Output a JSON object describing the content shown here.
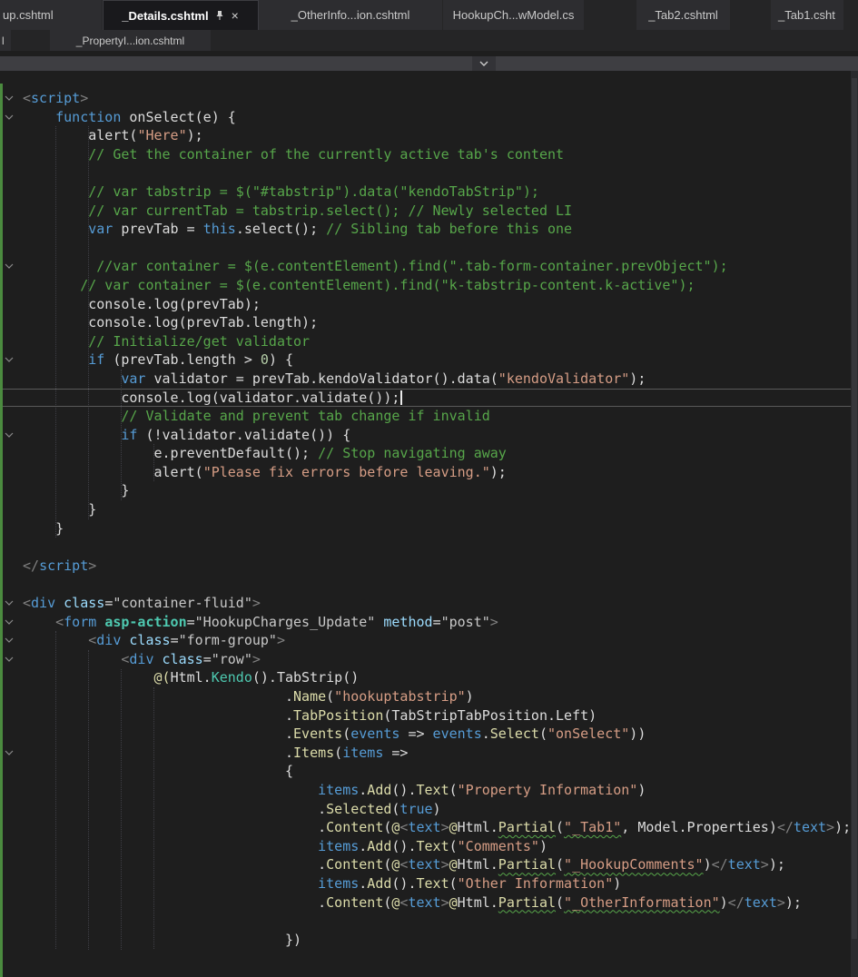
{
  "colors": {
    "background": "#1e1e1e",
    "tab_strip": "#252526",
    "tab_inactive": "#2d2d30",
    "tab_active": "#19191c",
    "keyword": "#569cd6",
    "string": "#d69d85",
    "comment": "#57a64a",
    "number": "#b5cea8",
    "method": "#dcdcaa",
    "type_teal": "#4ec9b0",
    "attribute": "#9cdcfe",
    "squiggle": "#57a64a",
    "change_bar": "#4b8b3f"
  },
  "icons": {
    "close_glyph": "×",
    "pin": "pin-icon",
    "fold": "chevron-down-icon",
    "overflow": "chevron-down-icon"
  },
  "tabs": {
    "row1": [
      {
        "label": "up.cshtml"
      },
      {
        "label": "_Details.cshtml",
        "active": true,
        "pinned": true,
        "closable": true
      },
      {
        "label": "_OtherInfo...ion.cshtml"
      },
      {
        "label": "HookupCh...wModel.cs"
      },
      {
        "label": "_Tab2.cshtml"
      },
      {
        "label": "_Tab1.csht"
      }
    ],
    "row2": [
      {
        "label": "l"
      },
      {
        "label": "_PropertyI...ion.cshtml"
      }
    ]
  },
  "editor": {
    "lines": [
      {
        "fold": true,
        "t": [
          [
            "tb",
            "<"
          ],
          [
            "tag",
            "script"
          ],
          [
            "tb",
            ">"
          ]
        ]
      },
      {
        "fold": true,
        "t": [
          [
            "d",
            "    "
          ],
          [
            "k",
            "function"
          ],
          [
            "d",
            " onSelect(e) {"
          ]
        ]
      },
      {
        "t": [
          [
            "d",
            "        alert("
          ],
          [
            "s",
            "\"Here\""
          ],
          [
            "d",
            ");"
          ]
        ]
      },
      {
        "t": [
          [
            "c",
            "        // Get the container of the currently active tab's content"
          ]
        ]
      },
      {
        "t": []
      },
      {
        "t": [
          [
            "c",
            "        // var tabstrip = $(\"#tabstrip\").data(\"kendoTabStrip\");"
          ]
        ]
      },
      {
        "t": [
          [
            "c",
            "        // var currentTab = tabstrip.select(); // Newly selected LI"
          ]
        ]
      },
      {
        "t": [
          [
            "d",
            "        "
          ],
          [
            "k",
            "var"
          ],
          [
            "d",
            " prevTab = "
          ],
          [
            "k",
            "this"
          ],
          [
            "d",
            ".select(); "
          ],
          [
            "c",
            "// Sibling tab before this one"
          ]
        ]
      },
      {
        "t": []
      },
      {
        "fold": true,
        "t": [
          [
            "c",
            "         //var container = $(e.contentElement).find(\".tab-form-container.prevObject\");"
          ]
        ]
      },
      {
        "t": [
          [
            "c",
            "       // var container = $(e.contentElement).find(\"k-tabstrip-content.k-active\");"
          ]
        ]
      },
      {
        "t": [
          [
            "d",
            "        console.log(prevTab);"
          ]
        ]
      },
      {
        "t": [
          [
            "d",
            "        console.log(prevTab.length);"
          ]
        ]
      },
      {
        "t": [
          [
            "c",
            "        // Initialize/get validator"
          ]
        ]
      },
      {
        "fold": true,
        "t": [
          [
            "d",
            "        "
          ],
          [
            "k",
            "if"
          ],
          [
            "d",
            " (prevTab.length > "
          ],
          [
            "n",
            "0"
          ],
          [
            "d",
            ") {"
          ]
        ]
      },
      {
        "t": [
          [
            "d",
            "            "
          ],
          [
            "k",
            "var"
          ],
          [
            "d",
            " validator = prevTab.kendoValidator().data("
          ],
          [
            "s",
            "\"kendoValidator\""
          ],
          [
            "d",
            ");"
          ]
        ]
      },
      {
        "cur": true,
        "t": [
          [
            "d",
            "            console.log(validator.validate());"
          ]
        ]
      },
      {
        "t": [
          [
            "c",
            "            // Validate and prevent tab change if invalid"
          ]
        ]
      },
      {
        "fold": true,
        "t": [
          [
            "d",
            "            "
          ],
          [
            "k",
            "if"
          ],
          [
            "d",
            " (!validator.validate()) {"
          ]
        ]
      },
      {
        "t": [
          [
            "d",
            "                e.preventDefault(); "
          ],
          [
            "c",
            "// Stop navigating away"
          ]
        ]
      },
      {
        "t": [
          [
            "d",
            "                alert("
          ],
          [
            "s",
            "\"Please fix errors before leaving.\""
          ],
          [
            "d",
            ");"
          ]
        ]
      },
      {
        "t": [
          [
            "d",
            "            }"
          ]
        ]
      },
      {
        "t": [
          [
            "d",
            "        }"
          ]
        ]
      },
      {
        "t": [
          [
            "d",
            "    }"
          ]
        ]
      },
      {
        "t": []
      },
      {
        "t": [
          [
            "tb",
            "</"
          ],
          [
            "tag",
            "script"
          ],
          [
            "tb",
            ">"
          ]
        ]
      },
      {
        "t": []
      },
      {
        "fold": true,
        "t": [
          [
            "tb",
            "<"
          ],
          [
            "tag",
            "div"
          ],
          [
            "d",
            " "
          ],
          [
            "at",
            "class"
          ],
          [
            "d",
            "="
          ],
          [
            "av",
            "\"container-fluid\""
          ],
          [
            "tb",
            ">"
          ]
        ]
      },
      {
        "fold": true,
        "t": [
          [
            "d",
            "    "
          ],
          [
            "tb",
            "<"
          ],
          [
            "tag",
            "form"
          ],
          [
            "d",
            " "
          ],
          [
            "th",
            "asp-action"
          ],
          [
            "d",
            "="
          ],
          [
            "av",
            "\"HookupCharges_Update\""
          ],
          [
            "d",
            " "
          ],
          [
            "at",
            "method"
          ],
          [
            "d",
            "="
          ],
          [
            "av",
            "\"post\""
          ],
          [
            "tb",
            ">"
          ]
        ]
      },
      {
        "fold": true,
        "t": [
          [
            "d",
            "        "
          ],
          [
            "tb",
            "<"
          ],
          [
            "tag",
            "div"
          ],
          [
            "d",
            " "
          ],
          [
            "at",
            "class"
          ],
          [
            "d",
            "="
          ],
          [
            "av",
            "\"form-group\""
          ],
          [
            "tb",
            ">"
          ]
        ]
      },
      {
        "fold": true,
        "t": [
          [
            "d",
            "            "
          ],
          [
            "tb",
            "<"
          ],
          [
            "tag",
            "div"
          ],
          [
            "d",
            " "
          ],
          [
            "at",
            "class"
          ],
          [
            "d",
            "="
          ],
          [
            "av",
            "\"row\""
          ],
          [
            "tb",
            ">"
          ]
        ]
      },
      {
        "t": [
          [
            "d",
            "                "
          ],
          [
            "rz",
            "@("
          ],
          [
            "d",
            "Html."
          ],
          [
            "te",
            "Kendo"
          ],
          [
            "d",
            "().TabStrip()"
          ]
        ]
      },
      {
        "t": [
          [
            "d",
            "                                ."
          ],
          [
            "m",
            "Name"
          ],
          [
            "d",
            "("
          ],
          [
            "s",
            "\"hookuptabstrip\""
          ],
          [
            "d",
            ")"
          ]
        ]
      },
      {
        "t": [
          [
            "d",
            "                                ."
          ],
          [
            "m",
            "TabPosition"
          ],
          [
            "d",
            "(TabStripTabPosition.Left)"
          ]
        ]
      },
      {
        "t": [
          [
            "d",
            "                                ."
          ],
          [
            "m",
            "Events"
          ],
          [
            "d",
            "("
          ],
          [
            "pb",
            "events"
          ],
          [
            "d",
            " => "
          ],
          [
            "pb",
            "events"
          ],
          [
            "d",
            "."
          ],
          [
            "m",
            "Select"
          ],
          [
            "d",
            "("
          ],
          [
            "s",
            "\"onSelect\""
          ],
          [
            "d",
            "))"
          ]
        ]
      },
      {
        "fold": true,
        "t": [
          [
            "d",
            "                                ."
          ],
          [
            "m",
            "Items"
          ],
          [
            "d",
            "("
          ],
          [
            "pb",
            "items"
          ],
          [
            "d",
            " =>"
          ]
        ]
      },
      {
        "t": [
          [
            "d",
            "                                {"
          ]
        ]
      },
      {
        "t": [
          [
            "d",
            "                                    "
          ],
          [
            "pb",
            "items"
          ],
          [
            "d",
            "."
          ],
          [
            "m",
            "Add"
          ],
          [
            "d",
            "()."
          ],
          [
            "m",
            "Text"
          ],
          [
            "d",
            "("
          ],
          [
            "s",
            "\"Property Information\""
          ],
          [
            "d",
            ")"
          ]
        ]
      },
      {
        "t": [
          [
            "d",
            "                                    ."
          ],
          [
            "m",
            "Selected"
          ],
          [
            "d",
            "("
          ],
          [
            "k",
            "true"
          ],
          [
            "d",
            ")"
          ]
        ]
      },
      {
        "t": [
          [
            "d",
            "                                    ."
          ],
          [
            "m",
            "Content"
          ],
          [
            "d",
            "("
          ],
          [
            "rz",
            "@"
          ],
          [
            "tb",
            "<"
          ],
          [
            "tag",
            "text"
          ],
          [
            "tb",
            ">"
          ],
          [
            "rz",
            "@"
          ],
          [
            "d",
            "Html."
          ],
          [
            "m sq",
            "Partial"
          ],
          [
            "d",
            "("
          ],
          [
            "s sq",
            "\"_Tab1\""
          ],
          [
            "d",
            ", Model.Properties)"
          ],
          [
            "tb",
            "</"
          ],
          [
            "tag",
            "text"
          ],
          [
            "tb",
            ">"
          ],
          [
            "d",
            ");"
          ]
        ]
      },
      {
        "t": [
          [
            "d",
            "                                    "
          ],
          [
            "pb",
            "items"
          ],
          [
            "d",
            "."
          ],
          [
            "m",
            "Add"
          ],
          [
            "d",
            "()."
          ],
          [
            "m",
            "Text"
          ],
          [
            "d",
            "("
          ],
          [
            "s",
            "\"Comments\""
          ],
          [
            "d",
            ")"
          ]
        ]
      },
      {
        "t": [
          [
            "d",
            "                                    ."
          ],
          [
            "m",
            "Content"
          ],
          [
            "d",
            "("
          ],
          [
            "rz",
            "@"
          ],
          [
            "tb",
            "<"
          ],
          [
            "tag",
            "text"
          ],
          [
            "tb",
            ">"
          ],
          [
            "rz",
            "@"
          ],
          [
            "d",
            "Html."
          ],
          [
            "m sq",
            "Partial"
          ],
          [
            "d",
            "("
          ],
          [
            "s sq",
            "\"_HookupComments\""
          ],
          [
            "d",
            ")"
          ],
          [
            "tb",
            "</"
          ],
          [
            "tag",
            "text"
          ],
          [
            "tb",
            ">"
          ],
          [
            "d",
            ");"
          ]
        ]
      },
      {
        "t": [
          [
            "d",
            "                                    "
          ],
          [
            "pb",
            "items"
          ],
          [
            "d",
            "."
          ],
          [
            "m",
            "Add"
          ],
          [
            "d",
            "()."
          ],
          [
            "m",
            "Text"
          ],
          [
            "d",
            "("
          ],
          [
            "s",
            "\"Other Information\""
          ],
          [
            "d",
            ")"
          ]
        ]
      },
      {
        "t": [
          [
            "d",
            "                                    ."
          ],
          [
            "m",
            "Content"
          ],
          [
            "d",
            "("
          ],
          [
            "rz",
            "@"
          ],
          [
            "tb",
            "<"
          ],
          [
            "tag",
            "text"
          ],
          [
            "tb",
            ">"
          ],
          [
            "rz",
            "@"
          ],
          [
            "d",
            "Html."
          ],
          [
            "m sq",
            "Partial"
          ],
          [
            "d",
            "("
          ],
          [
            "s sq",
            "\"_OtherInformation\""
          ],
          [
            "d",
            ")"
          ],
          [
            "tb",
            "</"
          ],
          [
            "tag",
            "text"
          ],
          [
            "tb",
            ">"
          ],
          [
            "d",
            ");"
          ]
        ]
      },
      {
        "t": []
      },
      {
        "t": [
          [
            "d",
            "                                })"
          ]
        ]
      }
    ]
  }
}
